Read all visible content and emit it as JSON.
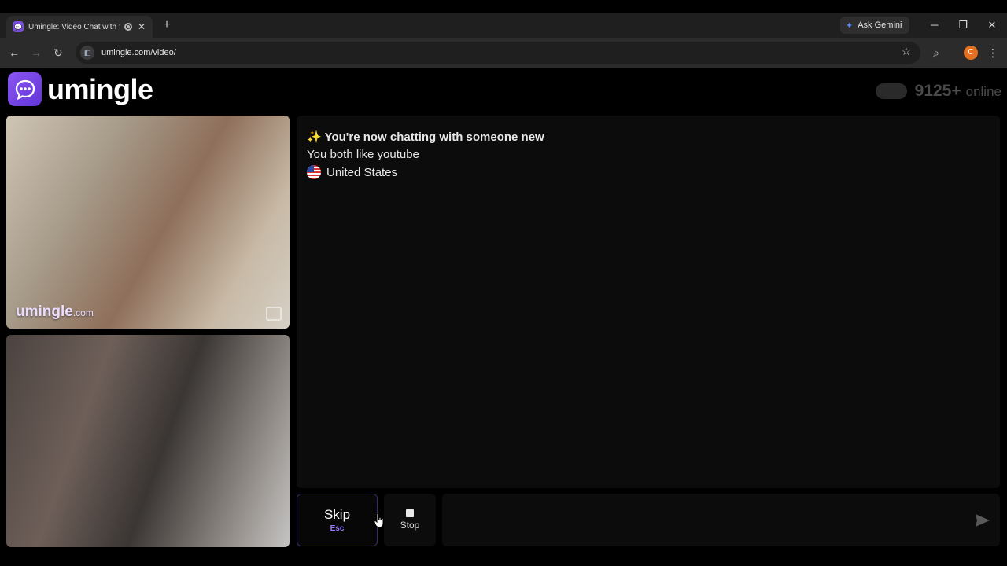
{
  "browser": {
    "tab_title": "Umingle: Video Chat with St",
    "new_tab_symbol": "+",
    "gemini_label": "Ask Gemini",
    "url": "umingle.com/video/",
    "profile_initial": "C"
  },
  "header": {
    "logo_text": "umingle",
    "online_count": "9125+",
    "online_label": "online"
  },
  "videos": {
    "watermark_main": "umingle",
    "watermark_suffix": ".com"
  },
  "chat": {
    "messages": [
      "✨ You're now chatting with someone new",
      "You both like youtube",
      "United States"
    ]
  },
  "controls": {
    "skip_label": "Skip",
    "skip_key": "Esc",
    "stop_label": "Stop",
    "message_value": ""
  },
  "colors": {
    "brand": "#7a4fd8",
    "accent": "#9a7bff",
    "profile": "#e4701f"
  }
}
